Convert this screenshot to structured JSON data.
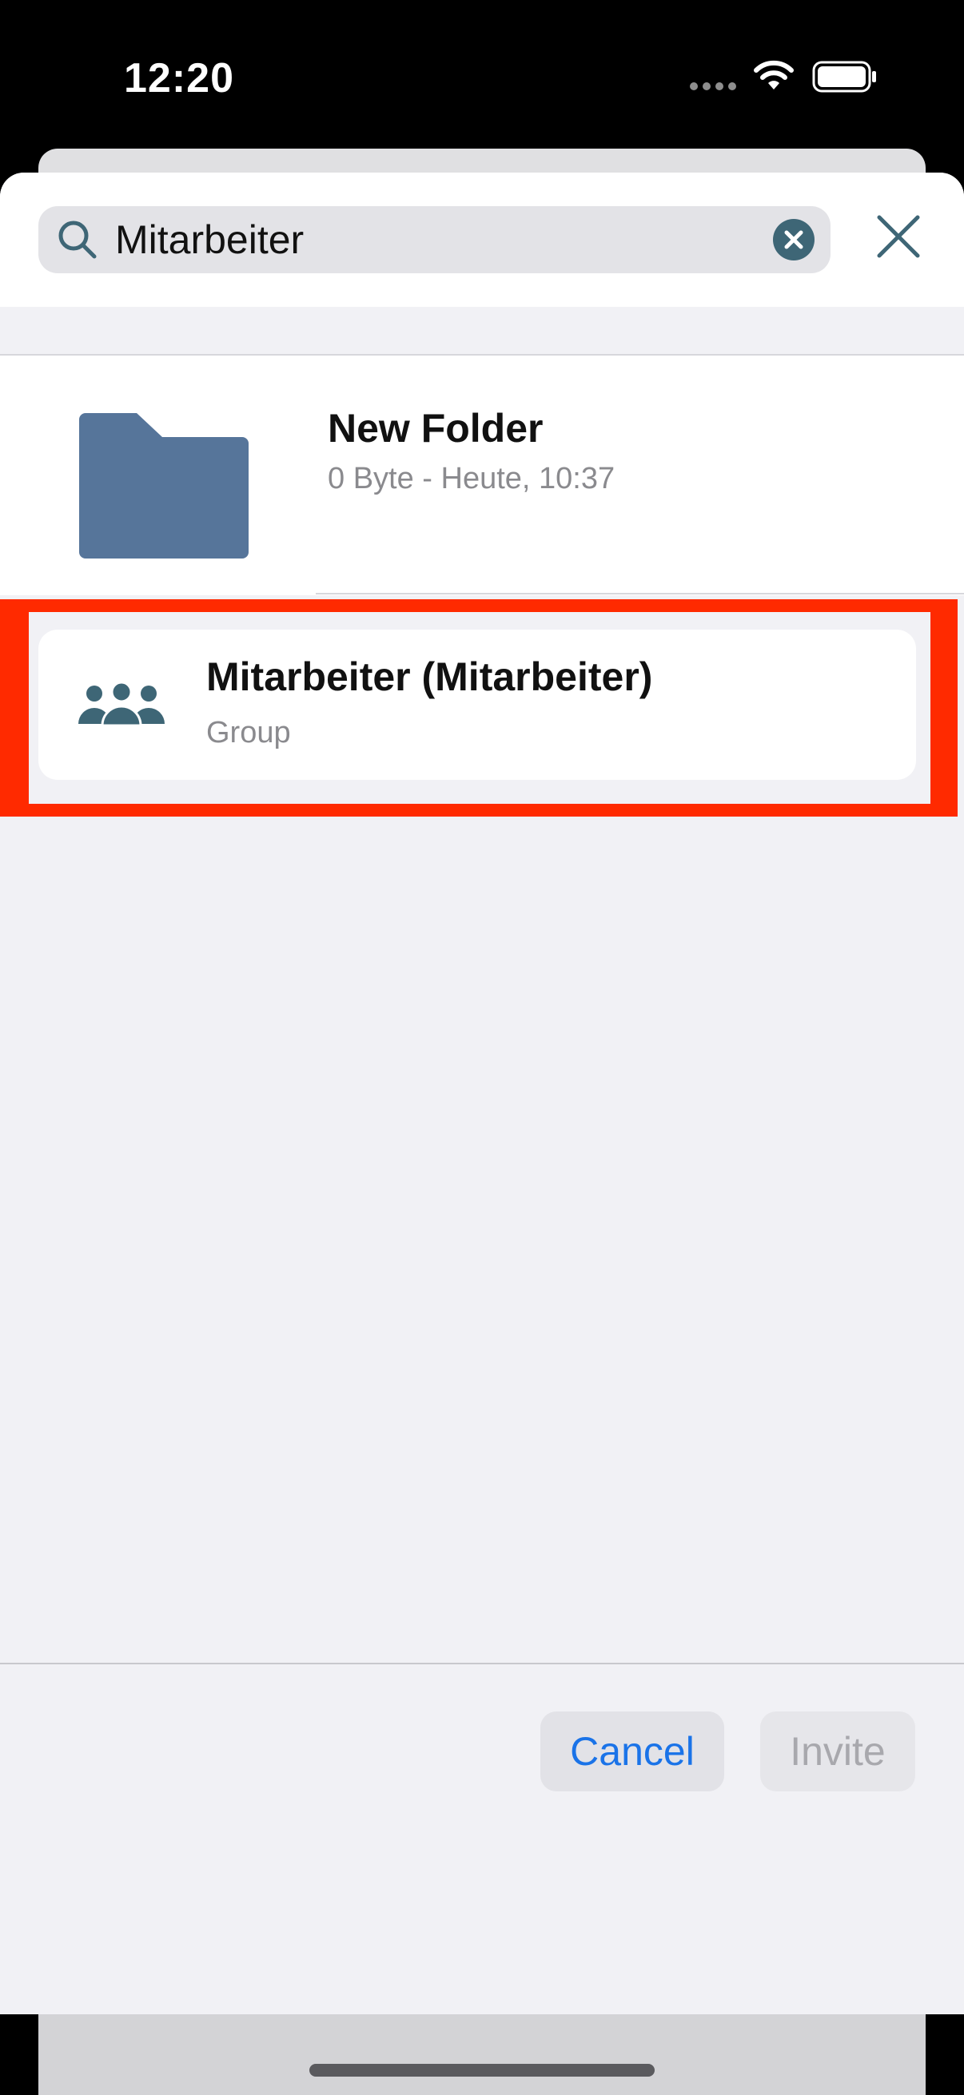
{
  "status_bar": {
    "time": "12:20"
  },
  "search": {
    "query": "Mitarbeiter",
    "icon": "search-icon"
  },
  "results": {
    "folder": {
      "name": "New Folder",
      "meta": "0 Byte - Heute, 10:37",
      "icon": "folder-icon"
    },
    "group": {
      "name": "Mitarbeiter (Mitarbeiter)",
      "type": "Group",
      "icon": "group-icon"
    }
  },
  "footer": {
    "cancel_label": "Cancel",
    "invite_label": "Invite"
  },
  "colors": {
    "accent": "#1a73e8",
    "folder": "#56759a",
    "group_icon": "#3e6676",
    "highlight": "#ff2a00"
  }
}
